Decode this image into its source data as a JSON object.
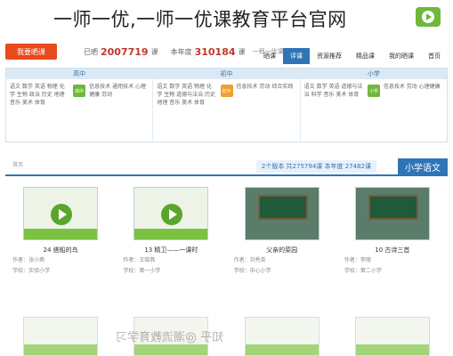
{
  "caption": "一师一优,一师一优课教育平台官网",
  "topbar": {
    "cta_label": "我要晒课",
    "stat_prefix": "已晒",
    "stat1": "2007719",
    "stat1_unit": "课",
    "stat2_prefix": "本年度",
    "stat2": "310184",
    "stat2_unit": "课",
    "logo_text": "一师一优课"
  },
  "nav": {
    "tabs": [
      "晒课",
      "评课",
      "资源推荐",
      "精品课",
      "我的晒课",
      "首页"
    ],
    "active_index": 1
  },
  "levels": [
    {
      "title": "高中",
      "col1": "语文 数学 英语 物理 化学 生物 政治 历史 地理 音乐 美术 体育",
      "col2": "信息技术 通用技术 心理健康 劳动",
      "badge": "高中"
    },
    {
      "title": "初中",
      "col1": "语文 数学 英语 物理 化学 生物 道德与法治 历史 地理 音乐 美术 体育",
      "col2": "信息技术 劳动 综合实践",
      "badge": "初中"
    },
    {
      "title": "小学",
      "col1": "语文 数学 英语 道德与法治 科学 音乐 美术 体育",
      "col2": "信息技术 劳动 心理健康",
      "badge": "小学"
    }
  ],
  "section": {
    "crumb": "首页",
    "title": "小学语文",
    "info": "2个版本 共275794课 本年度 27482课"
  },
  "cards": [
    {
      "title": "24 搭船的鸟",
      "meta1": "作者：张小燕",
      "meta2": "学校：实验小学",
      "style": "logo"
    },
    {
      "title": "13 精卫——一课时",
      "meta1": "作者：王晓燕",
      "meta2": "学校：第一小学",
      "style": "logo"
    },
    {
      "title": "父亲的菜园",
      "meta1": "作者：刘秀英",
      "meta2": "学校：中心小学",
      "style": "photo"
    },
    {
      "title": "10 古诗三首",
      "meta1": "作者：李丽",
      "meta2": "学校：第二小学",
      "style": "photo"
    }
  ],
  "watermark": "知乎 @潮流教育学习"
}
